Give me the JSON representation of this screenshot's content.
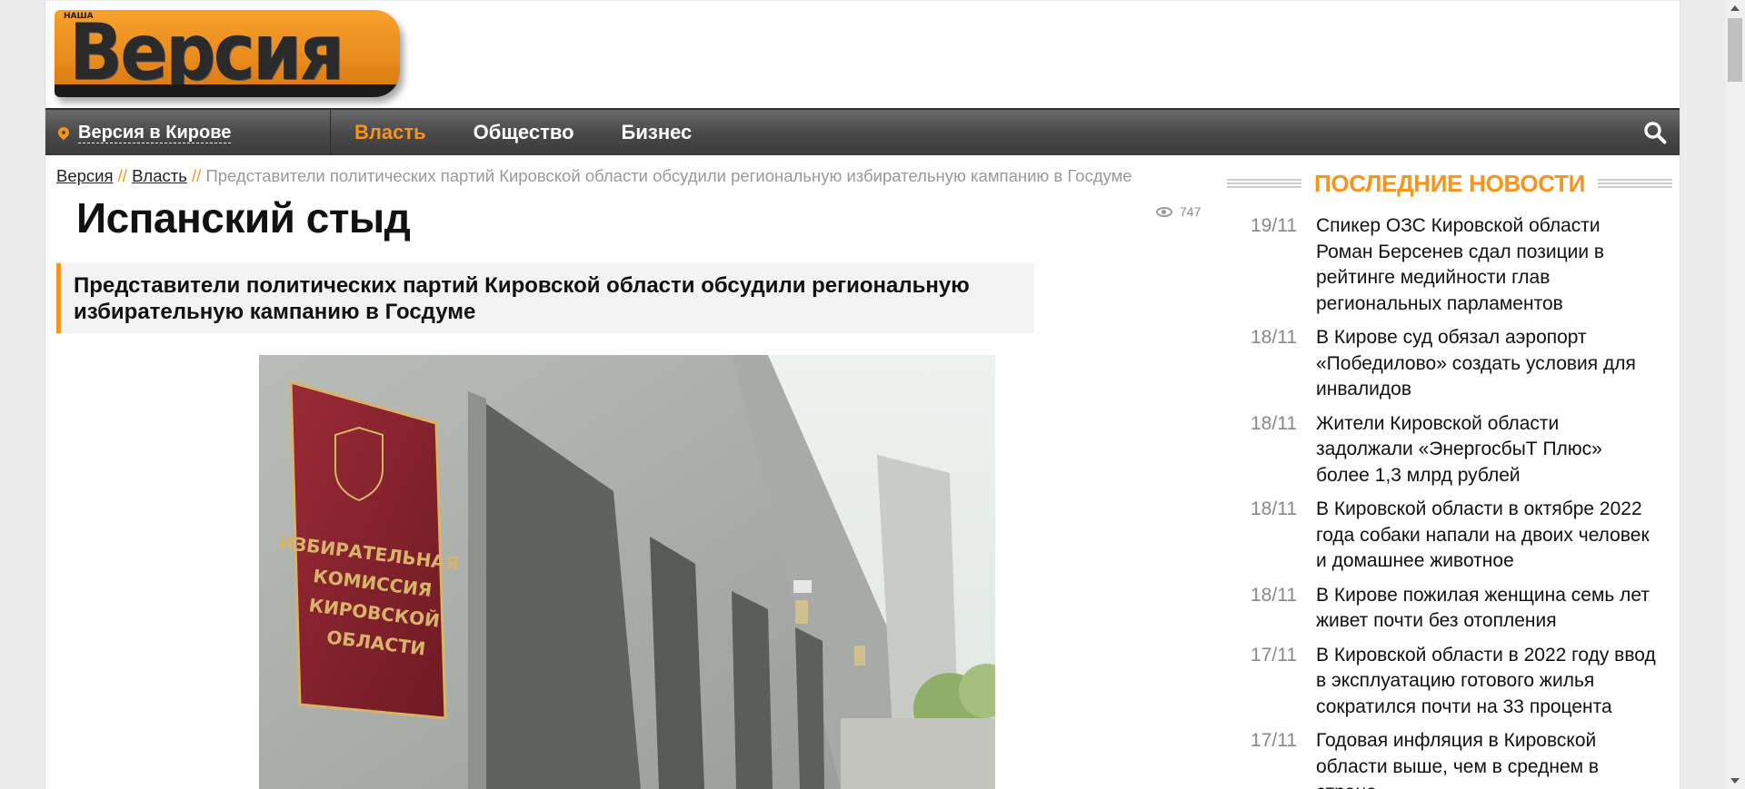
{
  "logo": {
    "top_text": "НАША",
    "word": "Версия"
  },
  "nav": {
    "location": "Версия в Кирове",
    "items": [
      {
        "label": "Власть",
        "active": true
      },
      {
        "label": "Общество",
        "active": false
      },
      {
        "label": "Бизнес",
        "active": false
      }
    ]
  },
  "breadcrumb": {
    "home": "Версия",
    "section": "Власть",
    "sep": "//",
    "current": "Представители политических партий Кировской области обсудили региональную избирательную кампанию в Госдуме"
  },
  "article": {
    "title": "Испанский стыд",
    "views": "747",
    "lead": "Представители политических партий Кировской области обсудили региональную избирательную кампанию в Госдуме",
    "photo_sign": [
      "ИЗБИРАТЕЛЬНАЯ",
      "КОМИССИЯ",
      "КИРОВСКОЙ",
      "ОБЛАСТИ"
    ]
  },
  "sidebar": {
    "title": "ПОСЛЕДНИЕ НОВОСТИ",
    "news": [
      {
        "date": "19/11",
        "text": "Спикер ОЗС Кировской области Роман Берсенев сдал позиции в рейтинге медийности глав региональных парламентов"
      },
      {
        "date": "18/11",
        "text": "В Кирове суд обязал аэропорт «Победилово» создать условия для инвалидов"
      },
      {
        "date": "18/11",
        "text": "Жители Кировской области задолжали «ЭнергосбыТ Плюс» более 1,3 млрд рублей"
      },
      {
        "date": "18/11",
        "text": "В Кировской области в октябре 2022 года собаки напали на двоих человек и домашнее животное"
      },
      {
        "date": "18/11",
        "text": "В Кирове пожилая женщина семь лет живет почти без отопления"
      },
      {
        "date": "17/11",
        "text": "В Кировской области в 2022 году ввод в эксплуатацию готового жилья сократился почти на 33 процента"
      },
      {
        "date": "17/11",
        "text": "Годовая инфляция в Кировской области выше, чем в среднем в стране"
      }
    ]
  },
  "colors": {
    "accent": "#f7941d",
    "nav_bg": "#4a4a4a",
    "sign": "#8b2430"
  }
}
